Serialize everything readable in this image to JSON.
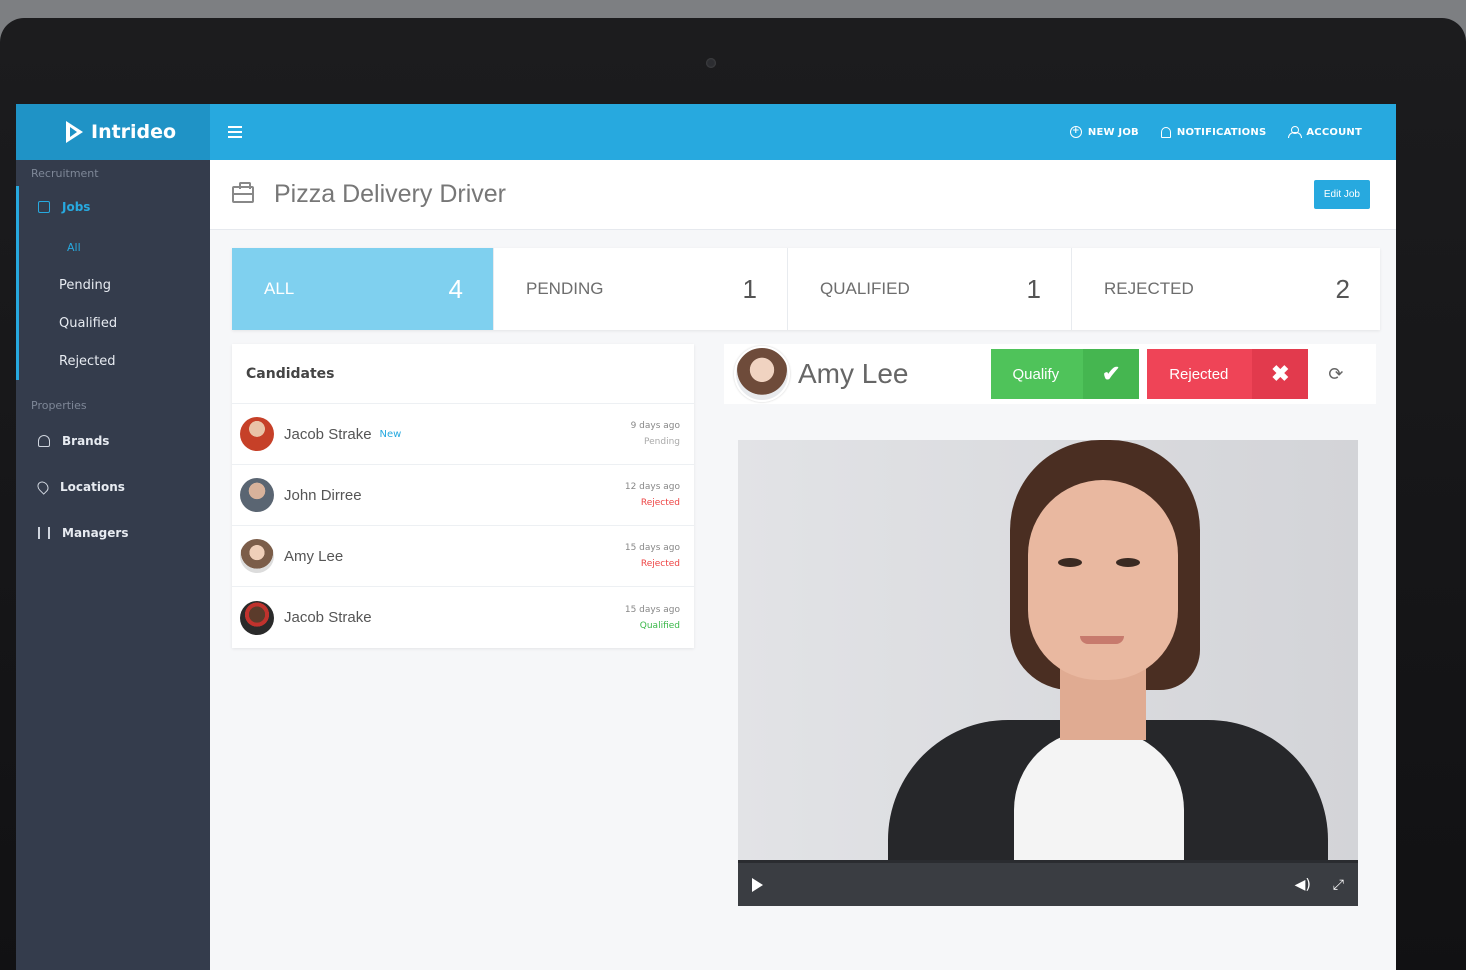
{
  "app": {
    "brand": "Intrideo"
  },
  "topnav": {
    "new_job": "NEW JOB",
    "notifications": "NOTIFICATIONS",
    "account": "ACCOUNT"
  },
  "sidebar": {
    "recruitment_heading": "Recruitment",
    "jobs_label": "Jobs",
    "sub_items": [
      "All",
      "Pending",
      "Qualified",
      "Rejected"
    ],
    "properties_heading": "Properties",
    "brands_label": "Brands",
    "locations_label": "Locations",
    "managers_label": "Managers"
  },
  "page": {
    "title": "Pizza Delivery Driver",
    "edit_button": "Edit Job"
  },
  "tabs": [
    {
      "label": "ALL",
      "count": "4"
    },
    {
      "label": "PENDING",
      "count": "1"
    },
    {
      "label": "QUALIFIED",
      "count": "1"
    },
    {
      "label": "REJECTED",
      "count": "2"
    }
  ],
  "candidates": {
    "heading": "Candidates",
    "rows": [
      {
        "name": "Jacob Strake",
        "tag": "New",
        "date": "9 days ago",
        "status": "Pending"
      },
      {
        "name": "John Dirree",
        "tag": "",
        "date": "12 days ago",
        "status": "Rejected"
      },
      {
        "name": "Amy Lee",
        "tag": "",
        "date": "15 days ago",
        "status": "Rejected"
      },
      {
        "name": "Jacob Strake",
        "tag": "",
        "date": "15 days ago",
        "status": "Qualified"
      }
    ]
  },
  "detail": {
    "name": "Amy Lee",
    "qualify_label": "Qualify",
    "reject_label": "Rejected"
  },
  "colors": {
    "accent": "#27a9df",
    "sidebar": "#343c4c",
    "qualify": "#4fc35a",
    "reject": "#ef4457"
  }
}
